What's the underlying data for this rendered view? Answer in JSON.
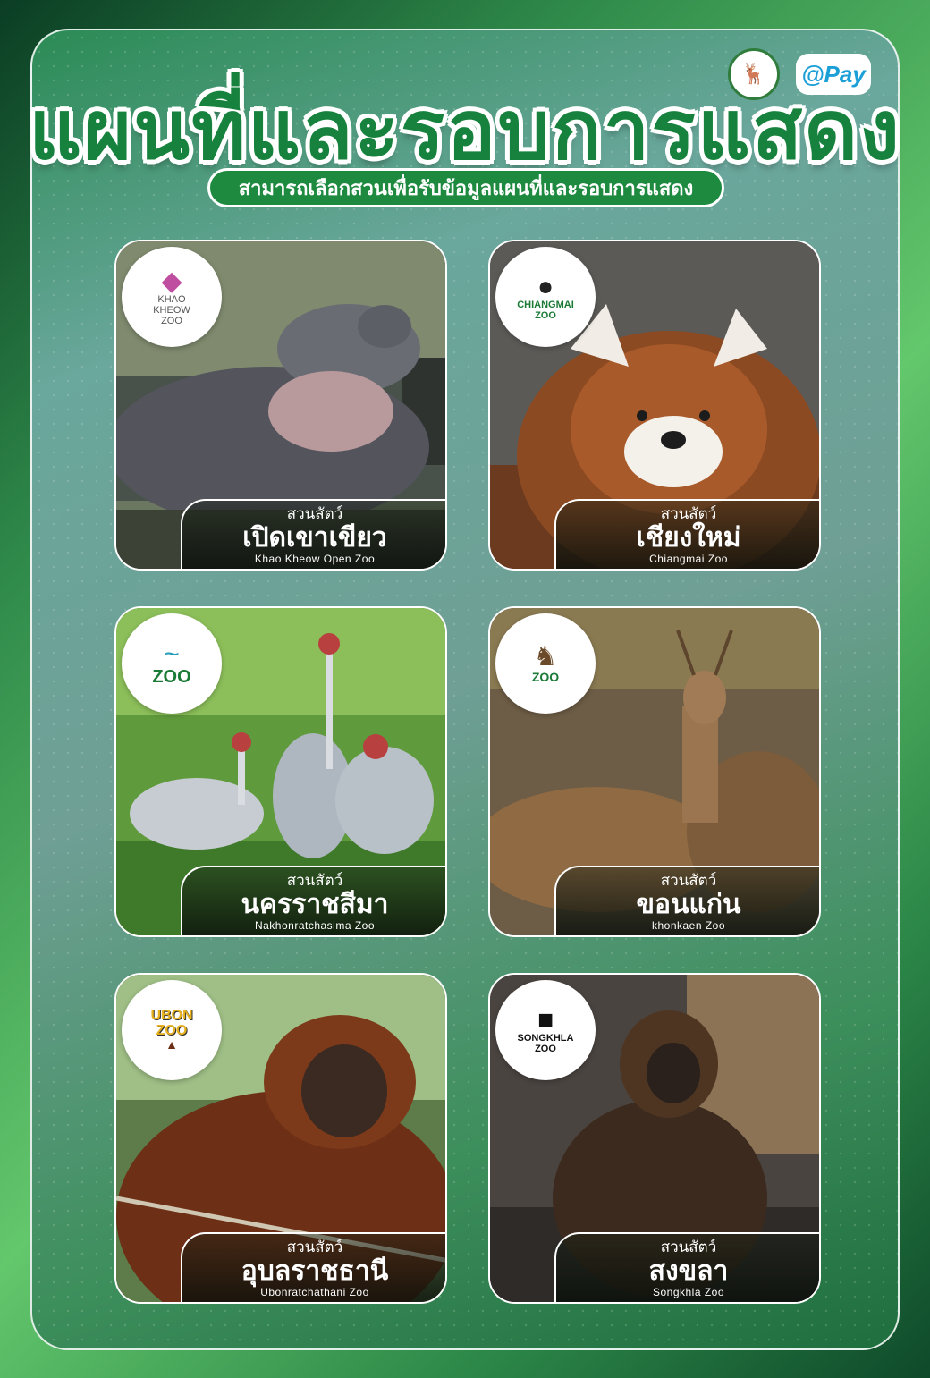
{
  "header": {
    "title": "แผนที่และรอบการแสดง",
    "subtitle": "สามารถเลือกสวนเพื่อรับข้อมูลแผนที่และรอบการแสดง",
    "pay_logo": "@Pay"
  },
  "zoos": [
    {
      "prefix": "สวนสัตว์",
      "name_th": "เปิดเขาเขียว",
      "name_en": "Khao Kheow Open Zoo",
      "logo_text": "KHAO KHEOW ZOO",
      "icon": "hippo-icon"
    },
    {
      "prefix": "สวนสัตว์",
      "name_th": "เชียงใหม่",
      "name_en": "Chiangmai Zoo",
      "logo_text": "CHIANGMAI ZOO",
      "icon": "panda-icon"
    },
    {
      "prefix": "สวนสัตว์",
      "name_th": "นครราชสีมา",
      "name_en": "Nakhonratchasima Zoo",
      "logo_text": "ZOO",
      "icon": "crane-icon"
    },
    {
      "prefix": "สวนสัตว์",
      "name_th": "ขอนแก่น",
      "name_en": "khonkaen Zoo",
      "logo_text": "ZOO",
      "icon": "deer-icon"
    },
    {
      "prefix": "สวนสัตว์",
      "name_th": "อุบลราชธานี",
      "name_en": "Ubonratchathani Zoo",
      "logo_text": "UBON ZOO",
      "icon": "orangutan-icon"
    },
    {
      "prefix": "สวนสัตว์",
      "name_th": "สงขลา",
      "name_en": "Songkhla Zoo",
      "logo_text": "SONGKHLA ZOO",
      "icon": "tapir-icon"
    }
  ]
}
